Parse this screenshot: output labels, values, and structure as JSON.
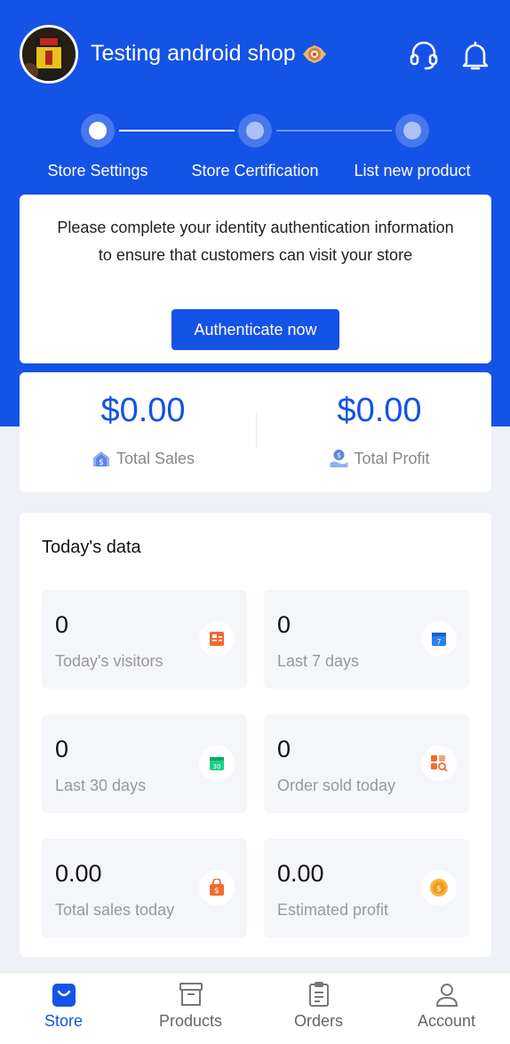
{
  "header": {
    "shop_name": "Testing android shop",
    "icons": [
      "headset-icon",
      "bell-icon"
    ]
  },
  "steps": [
    {
      "label": "Store Settings",
      "active": true
    },
    {
      "label": "Store Certification",
      "active": false
    },
    {
      "label": "List new product",
      "active": false
    }
  ],
  "auth": {
    "message": "Please complete your identity authentication information to ensure that customers can visit your store",
    "button_label": "Authenticate now"
  },
  "totals": {
    "sales_value": "$0.00",
    "sales_label": "Total Sales",
    "profit_value": "$0.00",
    "profit_label": "Total Profit"
  },
  "today": {
    "title": "Today's data",
    "stats": [
      {
        "value": "0",
        "label": "Today's visitors",
        "icon": "visitors-icon"
      },
      {
        "value": "0",
        "label": "Last 7 days",
        "icon": "calendar-7-icon"
      },
      {
        "value": "0",
        "label": "Last 30 days",
        "icon": "calendar-30-icon"
      },
      {
        "value": "0",
        "label": "Order sold today",
        "icon": "orders-search-icon"
      },
      {
        "value": "0.00",
        "label": "Total sales today",
        "icon": "shopping-bag-icon"
      },
      {
        "value": "0.00",
        "label": "Estimated profit",
        "icon": "coin-icon"
      }
    ]
  },
  "tabbar": {
    "items": [
      {
        "label": "Store",
        "active": true
      },
      {
        "label": "Products",
        "active": false
      },
      {
        "label": "Orders",
        "active": false
      },
      {
        "label": "Account",
        "active": false
      }
    ]
  },
  "colors": {
    "brand": "#1552e6",
    "background": "#eef1f6"
  }
}
